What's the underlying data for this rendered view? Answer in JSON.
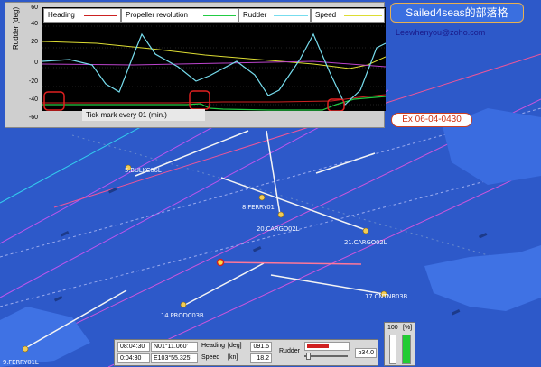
{
  "chart": {
    "y_axis_label": "Rudder (deg)",
    "y_ticks": [
      "60",
      "40",
      "20",
      "0",
      "-20",
      "-40",
      "-60"
    ],
    "legend": [
      "Heading",
      "Propeller revolution",
      "Rudder",
      "Speed"
    ],
    "tick_mark_note": "Tick mark every  01 (min.)",
    "colors": {
      "heading": "#cc2222",
      "propeller": "#22cc44",
      "rudder": "#77ddee",
      "speed": "#dddd33"
    }
  },
  "watermark": {
    "blog": "Sailed4seas的部落格",
    "email": "Leewhenyou@zoho.com",
    "date_stamp": "Ex 06-04-0430"
  },
  "ships": [
    {
      "label": "5.BULKC06L"
    },
    {
      "label": "8.FERRY01"
    },
    {
      "label": "20.CARGO02L"
    },
    {
      "label": "21.CARGO02L"
    },
    {
      "label": "14.PRODC03B"
    },
    {
      "label": "17.CNTNR03B"
    },
    {
      "label": "9.FERRY01L"
    }
  ],
  "hud": {
    "time1": "08:04:30",
    "pos1": "N01°11.060'",
    "time2": "0:04:30",
    "pos2": "E103°55.325'",
    "heading_label": "Heading",
    "heading_unit": "[deg]",
    "heading_value": "091.5",
    "speed_label": "Speed",
    "speed_unit": "[kn]",
    "speed_value": "18.2",
    "rudder_label": "Rudder",
    "rudder_value": "p34.0",
    "gauge_value": "100",
    "gauge_unit": "[%]"
  }
}
